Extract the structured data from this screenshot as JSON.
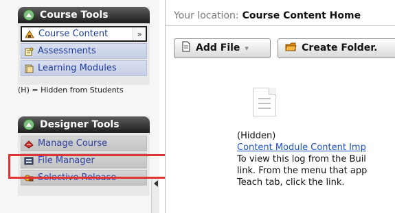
{
  "sidebar": {
    "course_tools": {
      "title": "Course Tools",
      "items": [
        {
          "label": "Course Content",
          "active": true,
          "dropdown": true,
          "icon": "course-content-icon"
        },
        {
          "label": "Assessments",
          "active": false,
          "icon": "assessments-icon"
        },
        {
          "label": "Learning Modules",
          "active": false,
          "icon": "learning-modules-icon"
        }
      ],
      "hidden_note": "(H) = Hidden from Students"
    },
    "designer_tools": {
      "title": "Designer Tools",
      "items": [
        {
          "label": "Manage Course",
          "icon": "manage-course-icon"
        },
        {
          "label": "File Manager",
          "icon": "file-manager-icon"
        },
        {
          "label": "Selective Release",
          "icon": "selective-release-icon"
        }
      ]
    }
  },
  "location": {
    "label": "Your location:",
    "current": "Course Content Home"
  },
  "toolbar": {
    "add_file": "Add File",
    "create_folder": "Create Folder."
  },
  "content": {
    "status": "(Hidden)",
    "link": "Content Module Content Imp",
    "line1": "To view this log from the Buil",
    "line2": "link. From the menu that app",
    "line3": "Teach tab, click the link."
  },
  "colors": {
    "highlight": "#e03434",
    "link": "#2051c7",
    "header_dark": "#1e1e1e"
  }
}
